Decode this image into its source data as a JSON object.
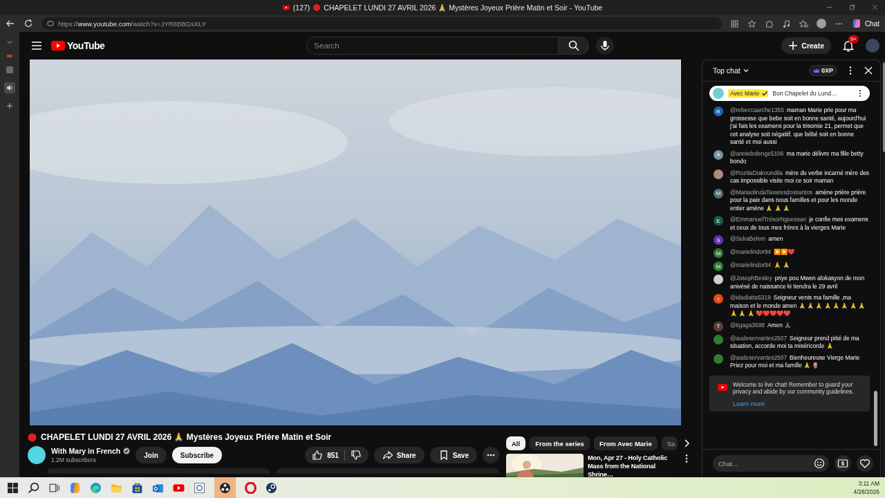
{
  "browser": {
    "title_count": "(127)",
    "title_main": "CHAPELET LUNDI 27 AVRIL 2026 🙏 Mystères Joyeux Prière Matin et Soir - YouTube",
    "url_scheme": "https://",
    "url_domain": "www.youtube.com",
    "url_path": "/watch?v=JYR8BBGsXLY",
    "chat_button": "Chat"
  },
  "header": {
    "logo": "YouTube",
    "search_placeholder": "Search",
    "create": "Create",
    "notification_badge": "9+"
  },
  "info": {
    "title": "CHAPELET LUNDI 27 AVRIL 2026 🙏 Mystères Joyeux Prière Matin et Soir",
    "channel": "With Mary in French",
    "verified": true,
    "subscribers": "1.2M subscribers",
    "join": "Join",
    "subscribe": "Subscribe",
    "likes": "851",
    "share": "Share",
    "save": "Save"
  },
  "chips": [
    {
      "label": "All",
      "selected": true
    },
    {
      "label": "From the series",
      "selected": false
    },
    {
      "label": "From Avec Marie",
      "selected": false
    },
    {
      "label": "Sa",
      "selected": false
    }
  ],
  "recommended": [
    {
      "title": "Mon, Apr 27 - Holy Catholic Mass from the National Shrine…"
    }
  ],
  "chat": {
    "title": "Top chat",
    "xp": "0XP",
    "pinned": {
      "author": "Avec Marie",
      "verified": true,
      "text": "Bon Chapelet du Lund…"
    },
    "messages": [
      {
        "initial": "R",
        "color": "#1e63b0",
        "author": "@rebeccaarche1355",
        "text": "maman Marie prie pour ma grossesse que bebe soit en bonne santé, aujourd'hui j'ai fais les examens pour la trisomie 21, permet que cet analyse soit négatiif. que bébé soit en bonne santé et moi aussi"
      },
      {
        "initial": "A",
        "color": "#78909c",
        "author": "@anniebolenge5106",
        "text": "ma marie délivre ma fille betty bondo"
      },
      {
        "color": "#b08a80",
        "author": "@RozitaDiakoundila",
        "text": "mère du verbe incarné mère des cas impossible visite moi ce soir maman"
      },
      {
        "initial": "M",
        "color": "#546e7a",
        "author": "@MariaolindaTavaresdossantos",
        "text": "amène prière prière pour la paix dans nous familles et pour les monde entier amène 🙏 🙏 🙏"
      },
      {
        "initial": "E",
        "color": "#1b5e3a",
        "author": "@EmmanuelTrésorNguessan",
        "text": "je confie mes examens et ceux de tous mes frères à la vierges Marie"
      },
      {
        "initial": "S",
        "color": "#5e35b1",
        "author": "@SekaBelem",
        "text": "amen"
      },
      {
        "initial": "M",
        "color": "#2e7d32",
        "author": "@marielindor94",
        "text": "▶️▶️❤️"
      },
      {
        "initial": "M",
        "color": "#2e7d32",
        "author": "@marielindor94",
        "text": "🙏 🙏"
      },
      {
        "color": "#cfcfcf",
        "author": "@JosephBesley",
        "text": "priye pou Mwen alokasyon de mon anivésé de naissance ki tiendra le 29 avril"
      },
      {
        "initial": "I",
        "color": "#e64a19",
        "author": "@idadiatta5319",
        "text": "Seigneur venis ma famille ,ma maison et le monde amen 🙏 🙏 🙏 🙏 🙏 🙏 🙏 🙏 🙏 🙏 🙏 ❤️❤️❤️❤️❤️"
      },
      {
        "initial": "T",
        "color": "#5d4037",
        "author": "@tigaga3698",
        "text": "Amen 🙏🏾"
      },
      {
        "color": "#2e7d32",
        "author": "@audeservantes2507",
        "text": "Seigneur prend pitié de ma situation, accorde moi ta miséricorde 🙏"
      },
      {
        "color": "#2e7d32",
        "author": "@audeservantes2507",
        "text": "Bienheureuse Vierge Marie Priez pour moi et ma famille 🙏 🌷"
      }
    ],
    "welcome": "Welcome to live chat! Remember to guard your privacy and abide by our community guidelines.",
    "learn_more": "Learn more",
    "input_placeholder": "Chat..."
  },
  "taskbar": {
    "time": "3:11 AM",
    "date": "4/28/2026"
  }
}
